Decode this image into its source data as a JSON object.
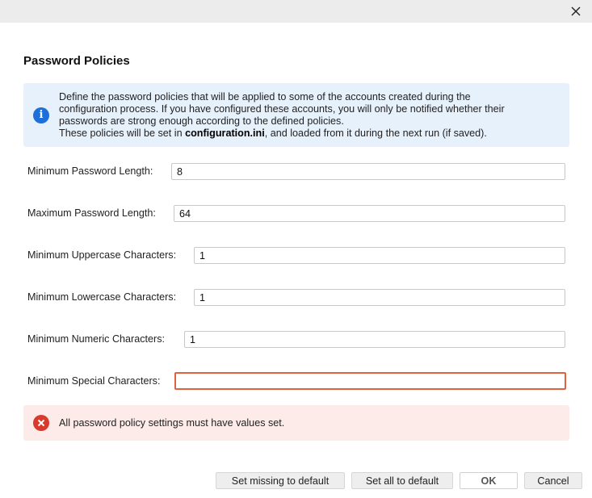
{
  "dialog": {
    "heading": "Password Policies"
  },
  "info": {
    "icon": "info-icon",
    "line1": "Define the password policies that will be applied to some of the accounts created during the",
    "line2": "configuration process. If you have configured these accounts, you will only be notified whether their",
    "line3": "passwords are strong enough according to the defined policies.",
    "line4_pre": "These policies will be set in ",
    "line4_bold": "configuration.ini",
    "line4_post": ", and loaded from it during the next run (if saved)."
  },
  "fields": {
    "min_length": {
      "label": "Minimum Password Length:",
      "value": "8"
    },
    "max_length": {
      "label": "Maximum Password Length:",
      "value": "64"
    },
    "min_upper": {
      "label": "Minimum Uppercase Characters:",
      "value": "1"
    },
    "min_lower": {
      "label": "Minimum Lowercase Characters:",
      "value": "1"
    },
    "min_numeric": {
      "label": "Minimum Numeric Characters:",
      "value": "1"
    },
    "min_special": {
      "label": "Minimum Special Characters:",
      "value": ""
    }
  },
  "error": {
    "icon": "error-icon",
    "message": "All password policy settings must have values set.",
    "color": "#d93a2b"
  },
  "buttons": {
    "set_missing": "Set missing to default",
    "set_all": "Set all to default",
    "ok": "OK",
    "cancel": "Cancel"
  },
  "colors": {
    "info_accent": "#1e6fd9",
    "error_border": "#e0623f"
  }
}
